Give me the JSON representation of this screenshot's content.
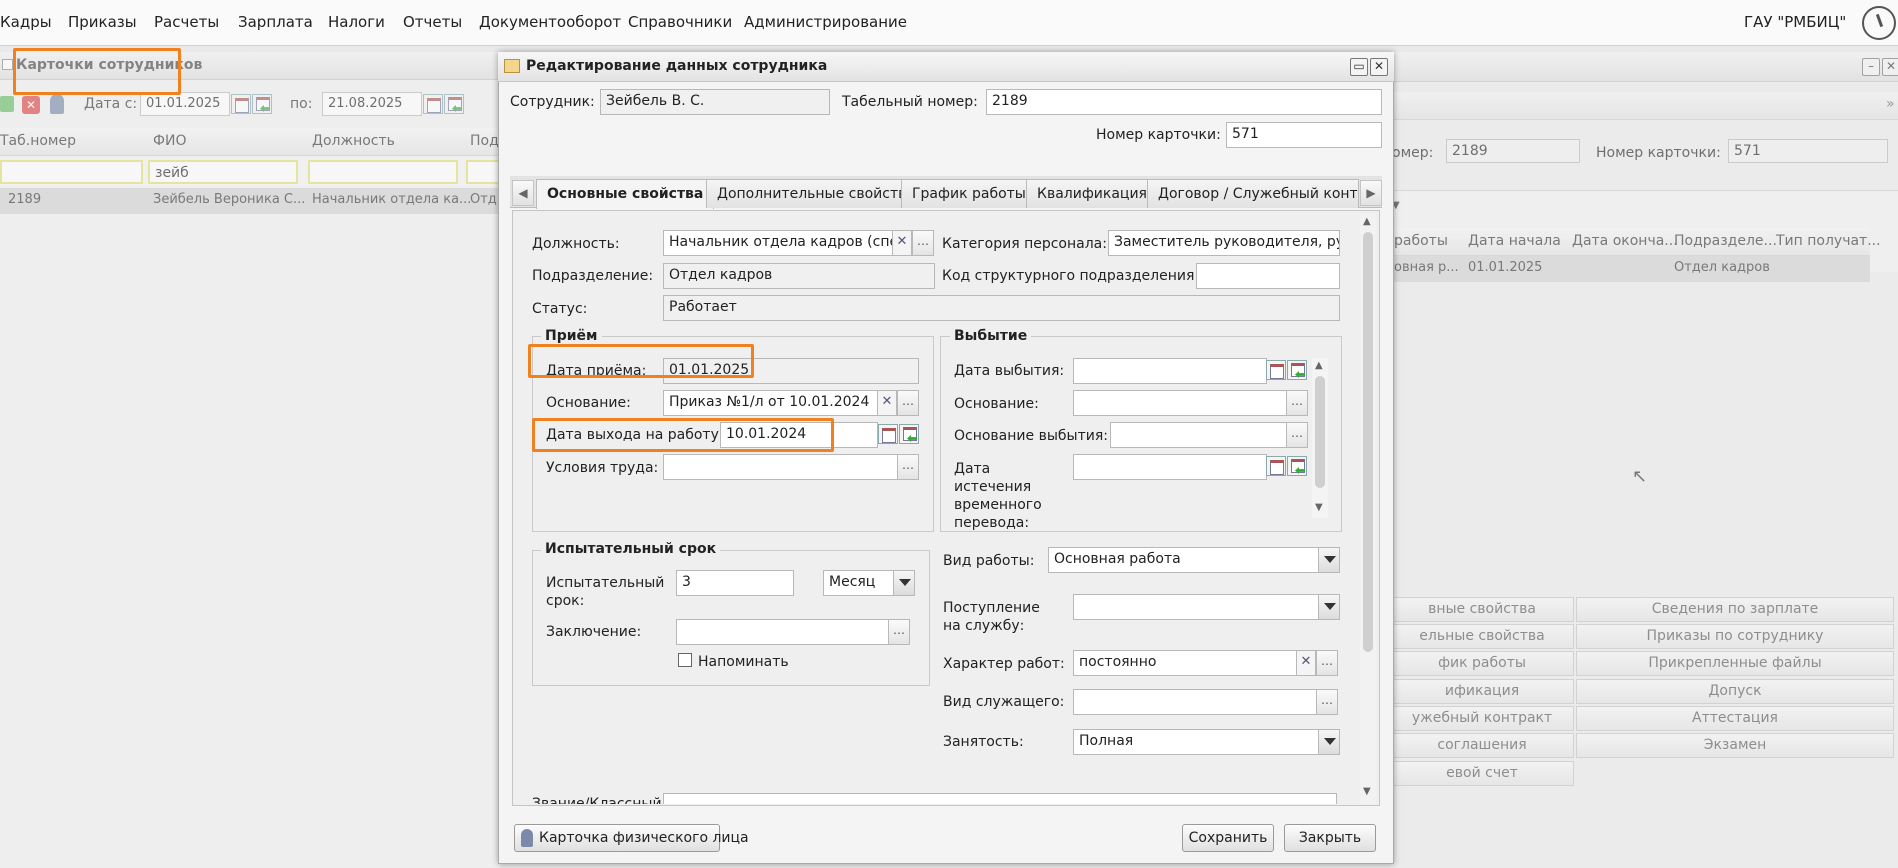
{
  "menu": {
    "items": [
      "Кадры",
      "Приказы",
      "Расчеты",
      "Зарплата",
      "Налоги",
      "Отчеты",
      "Документооборот",
      "Справочники",
      "Администрирование"
    ],
    "org": "ГАУ \"РМБИЦ\""
  },
  "left_panel": {
    "title": "Карточки сотрудников",
    "date_from_label": "Дата с:",
    "date_from": "01.01.2025",
    "date_to_label": "по:",
    "date_to": "21.08.2025",
    "columns": [
      "Таб.номер",
      "ФИО",
      "Должность",
      "Под"
    ],
    "filters": [
      "",
      "зейб",
      "",
      ""
    ],
    "rows": [
      [
        "2189",
        "Зейбель Вероника С...",
        "Начальник отдела ка...",
        "Отд"
      ]
    ]
  },
  "right_panel": {
    "tab_num_label": "омер:",
    "tab_num": "2189",
    "card_num_label": "Номер карточки:",
    "card_num": "571",
    "columns": [
      "работы",
      "Дата начала",
      "Дата оконча...",
      "Подразделе...",
      "Тип получат..."
    ],
    "rows": [
      [
        "овная р...",
        "01.01.2025",
        "",
        "Отдел кадров",
        ""
      ]
    ],
    "buttons_left": [
      "вные свойства",
      "ельные свойства",
      "фик работы",
      "ификация",
      "ужебный контракт",
      "соглашения",
      "евой счет"
    ],
    "buttons_right": [
      "Сведения по зарплате",
      "Приказы по сотруднику",
      "Прикрепленные файлы",
      "Допуск",
      "Аттестация",
      "Экзамен"
    ]
  },
  "modal": {
    "title": "Редактирование данных сотрудника",
    "employee_label": "Сотрудник:",
    "employee": "Зейбель В. С.",
    "tabnum_label": "Табельный номер:",
    "tabnum": "2189",
    "card_label": "Номер карточки:",
    "card": "571",
    "tabs": [
      "Основные свойства",
      "Дополнительные свойства",
      "График работы",
      "Квалификация",
      "Договор / Служебный контракт"
    ],
    "position_label": "Должность:",
    "position": "Начальник отдела кадров (спец",
    "category_label": "Категория персонала:",
    "category": "Заместитель руководителя, рукс",
    "division_label": "Подразделение:",
    "division": "Отдел кадров",
    "struct_code_label": "Код структурного подразделения:",
    "status_label": "Статус:",
    "status": "Работает",
    "hire": {
      "title": "Приём",
      "date_label": "Дата приёма:",
      "date": "01.01.2025",
      "basis_label": "Основание:",
      "basis": "Приказ №1/л от 10.01.2024",
      "start_label": "Дата выхода на работу:",
      "start": "10.01.2024",
      "conditions_label": "Условия труда:"
    },
    "leave": {
      "title": "Выбытие",
      "date_label": "Дата выбытия:",
      "basis_label": "Основание:",
      "reason_label": "Основание выбытия:",
      "transfer_label": "Дата истечения временного перевода:"
    },
    "probation": {
      "title": "Испытательный срок",
      "term_label": "Испытательный срок:",
      "term": "3",
      "unit": "Месяц",
      "conclusion_label": "Заключение:",
      "remind_label": "Напоминать"
    },
    "work_type_label": "Вид работы:",
    "work_type": "Основная работа",
    "entry_label": "Поступление на службу:",
    "nature_label": "Характер работ:",
    "nature": "постоянно",
    "servant_label": "Вид служащего:",
    "employment_label": "Занятость:",
    "employment": "Полная",
    "rank_label": "Звание/Классный",
    "person_card_button": "Карточка физического лица",
    "save_button": "Сохранить",
    "close_button": "Закрыть"
  }
}
